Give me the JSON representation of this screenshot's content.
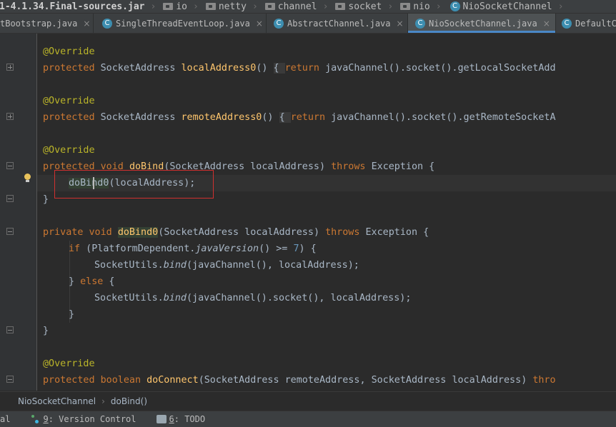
{
  "navbar": {
    "jar": "1-4.1.34.Final-sources.jar",
    "packages": [
      "io",
      "netty",
      "channel",
      "socket",
      "nio"
    ],
    "class_name": "NioSocketChannel",
    "class_icon": "C"
  },
  "tabs": [
    {
      "label": "tBootstrap.java",
      "icon": "",
      "close": "×",
      "active": false
    },
    {
      "label": "SingleThreadEventLoop.java",
      "icon": "C",
      "close": "×",
      "active": false
    },
    {
      "label": "AbstractChannel.java",
      "icon": "C",
      "close": "×",
      "active": false
    },
    {
      "label": "NioSocketChannel.java",
      "icon": "C",
      "close": "×",
      "active": true
    },
    {
      "label": "DefaultCh",
      "icon": "C",
      "close": "",
      "active": false
    }
  ],
  "code": {
    "override": "@Override",
    "protected": "protected",
    "private": "private",
    "void": "void",
    "boolean": "boolean",
    "return": "return",
    "throws": "throws",
    "if": "if",
    "else": "else",
    "socket_address": "SocketAddress",
    "exception": "Exception",
    "local_address0": "localAddress0",
    "remote_address0": "remoteAddress0",
    "local_body": "javaChannel().socket().getLocalSocketAdd",
    "remote_body": "javaChannel().socket().getRemoteSocketA",
    "do_bind": "doBind",
    "do_bind0": "doBind0",
    "do_connect": "doConnect",
    "local_address_param": "localAddress",
    "remote_address_param": "remoteAddress",
    "call_arg": "(localAddress);",
    "platform_dependent": "PlatformDependent.",
    "java_version": "javaVersion",
    "version_cmp": "() >= ",
    "version_num": "7",
    "socket_utils": "SocketUtils.",
    "bind": "bind",
    "bind_args1": "(javaChannel(), localAddress);",
    "bind_args2": "(javaChannel().socket(), localAddress);",
    "thro": "thro"
  },
  "bottom_breadcrumb": {
    "class": "NioSocketChannel",
    "method": "doBind()"
  },
  "tool_windows": {
    "terminal_tail": "al",
    "vc_num": "9",
    "vc_label": ": Version Control",
    "todo_num": "6",
    "todo_label": ": TODO"
  }
}
